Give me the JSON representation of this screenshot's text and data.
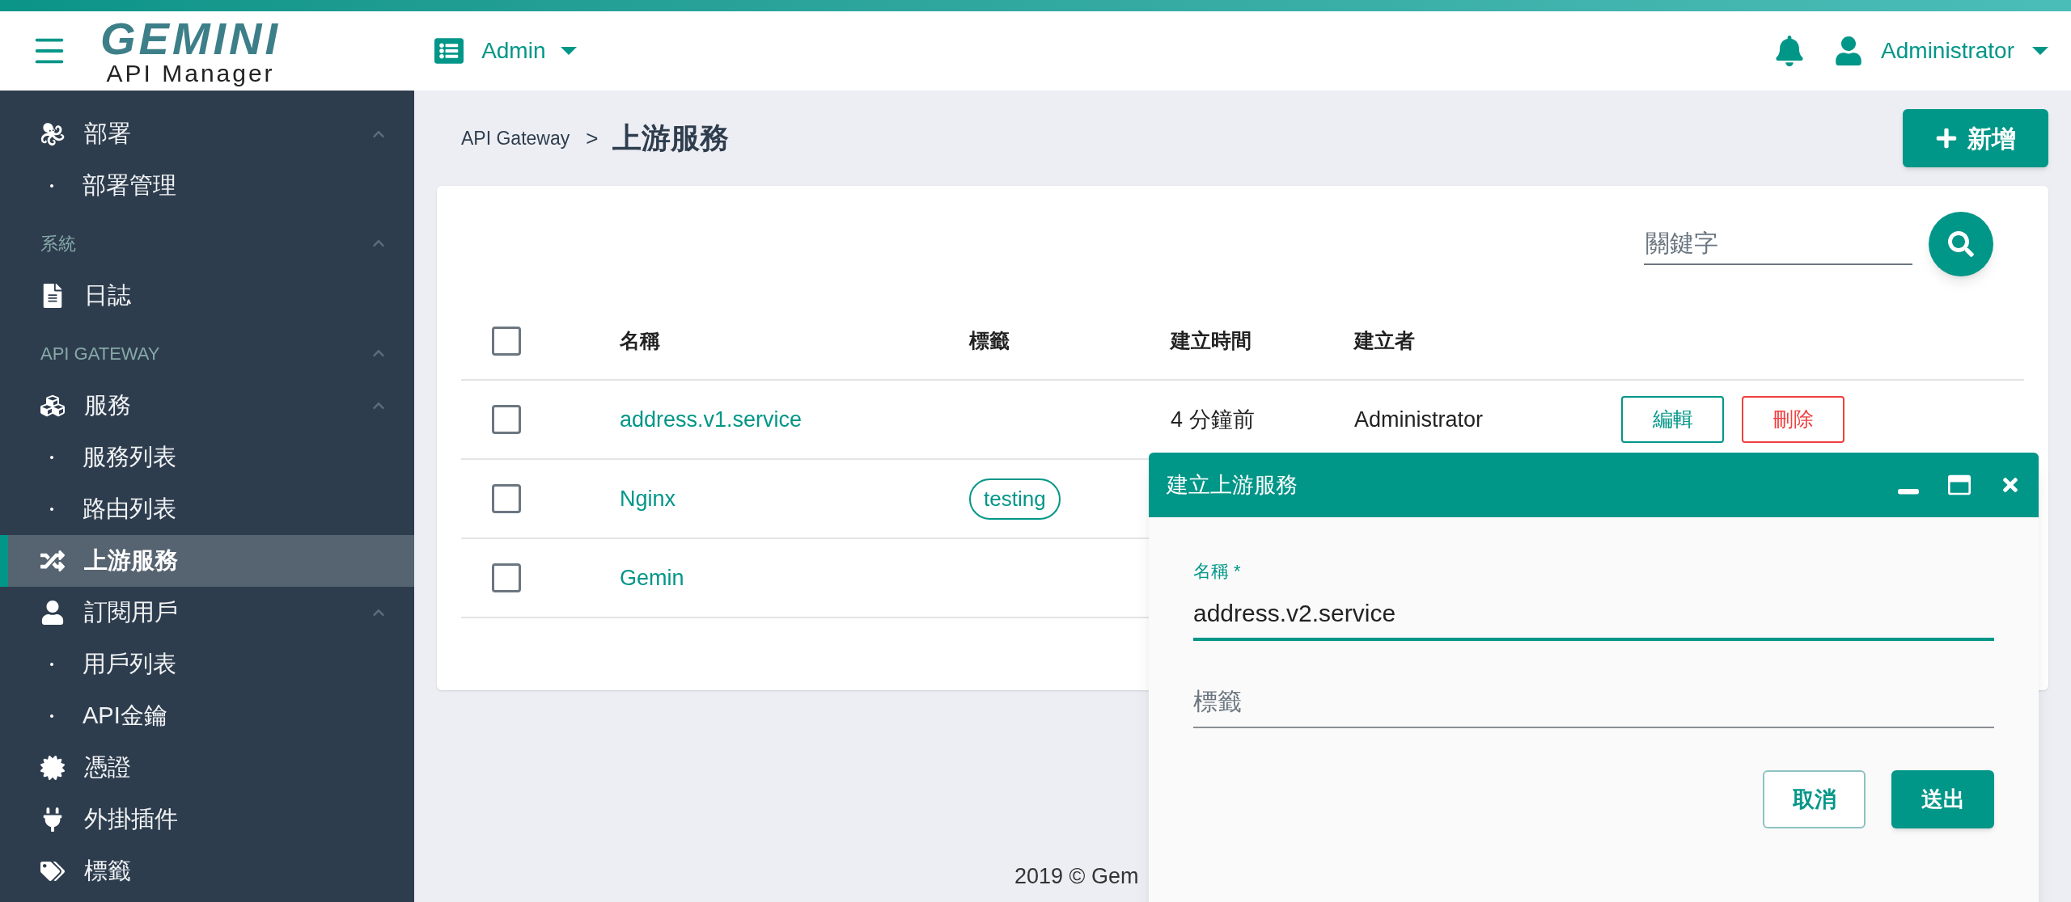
{
  "header": {
    "logo": {
      "title": "GEMINI",
      "subtitle": "API Manager"
    },
    "app_switcher": {
      "label": "Admin"
    },
    "user": {
      "name": "Administrator"
    }
  },
  "sidebar": {
    "items": [
      {
        "kind": "group",
        "label": "部署",
        "expanded": true,
        "selected": false,
        "children": [
          {
            "kind": "sub",
            "label": "部署管理",
            "selected": false
          }
        ]
      },
      {
        "kind": "section",
        "label": "系統",
        "expanded": true,
        "children": [
          {
            "kind": "link",
            "label": "日誌",
            "selected": false
          }
        ]
      },
      {
        "kind": "section",
        "label": "API GATEWAY",
        "expanded": true,
        "children": [
          {
            "kind": "group",
            "label": "服務",
            "expanded": true,
            "selected": false,
            "children": [
              {
                "kind": "sub",
                "label": "服務列表",
                "selected": false
              },
              {
                "kind": "sub",
                "label": "路由列表",
                "selected": false
              }
            ]
          },
          {
            "kind": "link",
            "label": "上游服務",
            "selected": true
          },
          {
            "kind": "group",
            "label": "訂閱用戶",
            "expanded": true,
            "selected": false,
            "children": [
              {
                "kind": "sub",
                "label": "用戶列表",
                "selected": false
              },
              {
                "kind": "sub",
                "label": "API金鑰",
                "selected": false
              }
            ]
          },
          {
            "kind": "link",
            "label": "憑證",
            "selected": false
          },
          {
            "kind": "link",
            "label": "外掛插件",
            "selected": false
          },
          {
            "kind": "link",
            "label": "標籤",
            "selected": false
          }
        ]
      }
    ]
  },
  "breadcrumb": {
    "parent": "API Gateway",
    "separator": ">",
    "title": "上游服務"
  },
  "add_button": {
    "label": "新增"
  },
  "search": {
    "placeholder": "關鍵字"
  },
  "table": {
    "select_all": {
      "checked": false
    },
    "columns": [
      "名稱",
      "標籤",
      "建立時間",
      "建立者"
    ],
    "rows": [
      {
        "checked": false,
        "name": "address.v1.service",
        "tags": [],
        "time": "4 分鐘前",
        "creator": "Administrator",
        "actions": [
          {
            "kind": "edit",
            "label": "編輯"
          },
          {
            "kind": "delete",
            "label": "刪除"
          }
        ]
      },
      {
        "checked": false,
        "name": "Nginx",
        "tags": [
          "testing"
        ],
        "actions": []
      },
      {
        "checked": false,
        "name": "Gemin",
        "tags": [],
        "actions": []
      }
    ]
  },
  "footer": {
    "text": "2019 © Gem"
  },
  "dialog": {
    "title": "建立上游服務",
    "fields": [
      {
        "label": "名稱 *",
        "value": "address.v2.service",
        "focused": true
      },
      {
        "placeholder": "標籤",
        "focused": false
      }
    ],
    "buttons": [
      {
        "kind": "secondary",
        "label": "取消"
      },
      {
        "kind": "primary",
        "label": "送出"
      }
    ]
  }
}
